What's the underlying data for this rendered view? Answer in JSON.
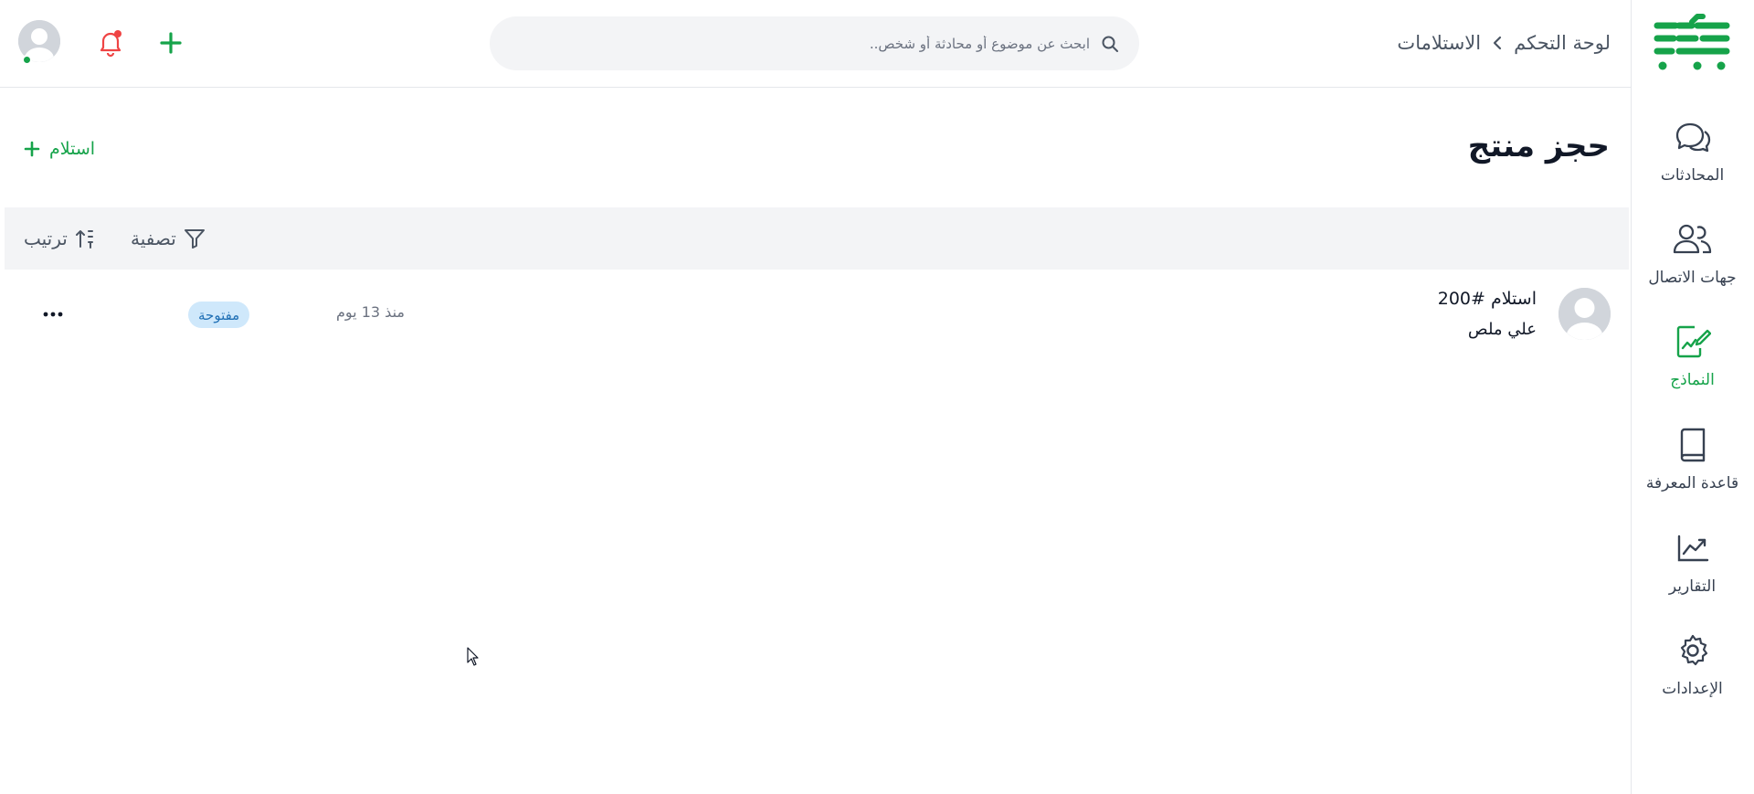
{
  "breadcrumb": {
    "root": "لوحة التحكم",
    "current": "الاستلامات"
  },
  "search": {
    "placeholder": "ابحث عن موضوع أو محادثة أو شخص.."
  },
  "sidebar": {
    "items": [
      {
        "label": "المحادثات",
        "icon": "chat-bubbles-icon"
      },
      {
        "label": "جهات الاتصال",
        "icon": "contacts-icon"
      },
      {
        "label": "النماذج",
        "icon": "form-edit-icon",
        "active": true
      },
      {
        "label": "قاعدة المعرفة",
        "icon": "book-icon"
      },
      {
        "label": "التقارير",
        "icon": "chart-icon"
      },
      {
        "label": "الإعدادات",
        "icon": "gear-icon"
      }
    ]
  },
  "page": {
    "title": "حجز منتج",
    "add_label": "استلام"
  },
  "toolbar": {
    "filter_label": "تصفية",
    "sort_label": "ترتيب"
  },
  "rows": [
    {
      "title": "استلام #200",
      "subtitle": "علي ملص",
      "time": "منذ 13 يوم",
      "status": "مفتوحة"
    }
  ],
  "colors": {
    "accent": "#16a34a",
    "badge_bg": "#cfe8fb",
    "badge_text": "#1f6fb5",
    "notification": "#ef4444"
  }
}
